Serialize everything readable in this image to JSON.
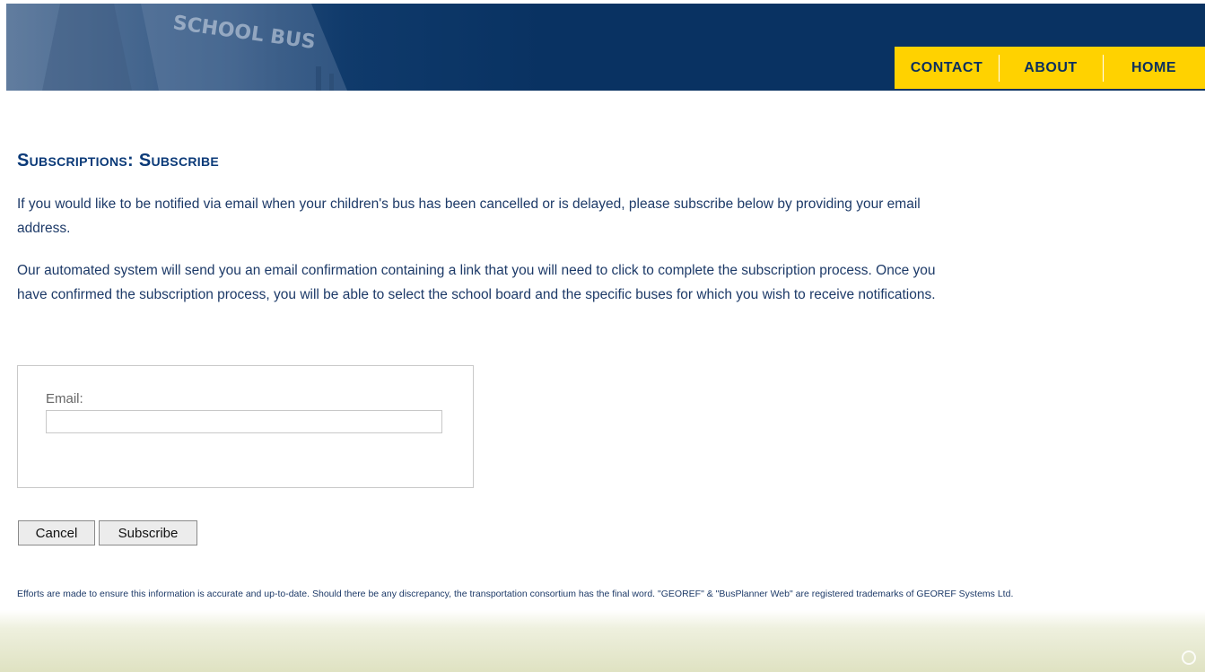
{
  "header": {
    "banner_text": "SCHOOL BUS",
    "nav": {
      "contact": "CONTACT",
      "about": "ABOUT",
      "home": "HOME"
    }
  },
  "main": {
    "title": "Subscriptions: Subscribe",
    "intro_1": "If you would like to be notified via email when your children's bus has been cancelled or is delayed, please subscribe below by providing your email address.",
    "intro_2": "Our automated system will send you an email confirmation containing a link that you will need to click to complete the subscription process. Once you have confirmed the subscription process, you will be able to select the school board and the specific buses for which you wish to receive notifications.",
    "form": {
      "email_label": "Email:",
      "email_value": ""
    },
    "buttons": {
      "cancel": "Cancel",
      "subscribe": "Subscribe"
    }
  },
  "footer": {
    "disclaimer": "Efforts are made to ensure this information is accurate and up-to-date. Should there be any discrepancy, the transportation consortium has the final word. \"GEOREF\" & \"BusPlanner Web\" are registered trademarks of GEOREF Systems Ltd."
  },
  "icons": {
    "corner": "georef-logo-icon"
  },
  "colors": {
    "header_blue": "#093262",
    "nav_yellow": "#ffd200",
    "title_blue": "#0b3a78",
    "text_blue": "#1d3a68"
  }
}
